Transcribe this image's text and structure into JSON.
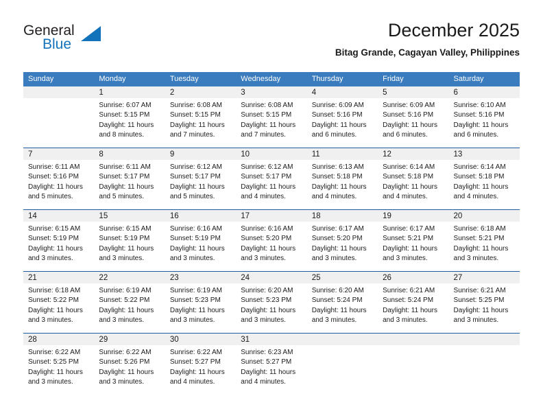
{
  "logo": {
    "word_one": "General",
    "word_two": "Blue",
    "accent_color": "#1272ba",
    "triangle_icon": "triangle-icon"
  },
  "header": {
    "title": "December 2025",
    "subtitle": "Bitag Grande, Cagayan Valley, Philippines"
  },
  "calendar": {
    "header_bg": "#3a7cbe",
    "daynum_bg": "#f0f0f0",
    "divider_color": "#1c5c9e",
    "weekday_headers": [
      "Sunday",
      "Monday",
      "Tuesday",
      "Wednesday",
      "Thursday",
      "Friday",
      "Saturday"
    ],
    "weeks": [
      [
        {
          "day": "",
          "sunrise": "",
          "sunset": "",
          "daylight_1": "",
          "daylight_2": ""
        },
        {
          "day": "1",
          "sunrise": "Sunrise: 6:07 AM",
          "sunset": "Sunset: 5:15 PM",
          "daylight_1": "Daylight: 11 hours",
          "daylight_2": "and 8 minutes."
        },
        {
          "day": "2",
          "sunrise": "Sunrise: 6:08 AM",
          "sunset": "Sunset: 5:15 PM",
          "daylight_1": "Daylight: 11 hours",
          "daylight_2": "and 7 minutes."
        },
        {
          "day": "3",
          "sunrise": "Sunrise: 6:08 AM",
          "sunset": "Sunset: 5:15 PM",
          "daylight_1": "Daylight: 11 hours",
          "daylight_2": "and 7 minutes."
        },
        {
          "day": "4",
          "sunrise": "Sunrise: 6:09 AM",
          "sunset": "Sunset: 5:16 PM",
          "daylight_1": "Daylight: 11 hours",
          "daylight_2": "and 6 minutes."
        },
        {
          "day": "5",
          "sunrise": "Sunrise: 6:09 AM",
          "sunset": "Sunset: 5:16 PM",
          "daylight_1": "Daylight: 11 hours",
          "daylight_2": "and 6 minutes."
        },
        {
          "day": "6",
          "sunrise": "Sunrise: 6:10 AM",
          "sunset": "Sunset: 5:16 PM",
          "daylight_1": "Daylight: 11 hours",
          "daylight_2": "and 6 minutes."
        }
      ],
      [
        {
          "day": "7",
          "sunrise": "Sunrise: 6:11 AM",
          "sunset": "Sunset: 5:16 PM",
          "daylight_1": "Daylight: 11 hours",
          "daylight_2": "and 5 minutes."
        },
        {
          "day": "8",
          "sunrise": "Sunrise: 6:11 AM",
          "sunset": "Sunset: 5:17 PM",
          "daylight_1": "Daylight: 11 hours",
          "daylight_2": "and 5 minutes."
        },
        {
          "day": "9",
          "sunrise": "Sunrise: 6:12 AM",
          "sunset": "Sunset: 5:17 PM",
          "daylight_1": "Daylight: 11 hours",
          "daylight_2": "and 5 minutes."
        },
        {
          "day": "10",
          "sunrise": "Sunrise: 6:12 AM",
          "sunset": "Sunset: 5:17 PM",
          "daylight_1": "Daylight: 11 hours",
          "daylight_2": "and 4 minutes."
        },
        {
          "day": "11",
          "sunrise": "Sunrise: 6:13 AM",
          "sunset": "Sunset: 5:18 PM",
          "daylight_1": "Daylight: 11 hours",
          "daylight_2": "and 4 minutes."
        },
        {
          "day": "12",
          "sunrise": "Sunrise: 6:14 AM",
          "sunset": "Sunset: 5:18 PM",
          "daylight_1": "Daylight: 11 hours",
          "daylight_2": "and 4 minutes."
        },
        {
          "day": "13",
          "sunrise": "Sunrise: 6:14 AM",
          "sunset": "Sunset: 5:18 PM",
          "daylight_1": "Daylight: 11 hours",
          "daylight_2": "and 4 minutes."
        }
      ],
      [
        {
          "day": "14",
          "sunrise": "Sunrise: 6:15 AM",
          "sunset": "Sunset: 5:19 PM",
          "daylight_1": "Daylight: 11 hours",
          "daylight_2": "and 3 minutes."
        },
        {
          "day": "15",
          "sunrise": "Sunrise: 6:15 AM",
          "sunset": "Sunset: 5:19 PM",
          "daylight_1": "Daylight: 11 hours",
          "daylight_2": "and 3 minutes."
        },
        {
          "day": "16",
          "sunrise": "Sunrise: 6:16 AM",
          "sunset": "Sunset: 5:19 PM",
          "daylight_1": "Daylight: 11 hours",
          "daylight_2": "and 3 minutes."
        },
        {
          "day": "17",
          "sunrise": "Sunrise: 6:16 AM",
          "sunset": "Sunset: 5:20 PM",
          "daylight_1": "Daylight: 11 hours",
          "daylight_2": "and 3 minutes."
        },
        {
          "day": "18",
          "sunrise": "Sunrise: 6:17 AM",
          "sunset": "Sunset: 5:20 PM",
          "daylight_1": "Daylight: 11 hours",
          "daylight_2": "and 3 minutes."
        },
        {
          "day": "19",
          "sunrise": "Sunrise: 6:17 AM",
          "sunset": "Sunset: 5:21 PM",
          "daylight_1": "Daylight: 11 hours",
          "daylight_2": "and 3 minutes."
        },
        {
          "day": "20",
          "sunrise": "Sunrise: 6:18 AM",
          "sunset": "Sunset: 5:21 PM",
          "daylight_1": "Daylight: 11 hours",
          "daylight_2": "and 3 minutes."
        }
      ],
      [
        {
          "day": "21",
          "sunrise": "Sunrise: 6:18 AM",
          "sunset": "Sunset: 5:22 PM",
          "daylight_1": "Daylight: 11 hours",
          "daylight_2": "and 3 minutes."
        },
        {
          "day": "22",
          "sunrise": "Sunrise: 6:19 AM",
          "sunset": "Sunset: 5:22 PM",
          "daylight_1": "Daylight: 11 hours",
          "daylight_2": "and 3 minutes."
        },
        {
          "day": "23",
          "sunrise": "Sunrise: 6:19 AM",
          "sunset": "Sunset: 5:23 PM",
          "daylight_1": "Daylight: 11 hours",
          "daylight_2": "and 3 minutes."
        },
        {
          "day": "24",
          "sunrise": "Sunrise: 6:20 AM",
          "sunset": "Sunset: 5:23 PM",
          "daylight_1": "Daylight: 11 hours",
          "daylight_2": "and 3 minutes."
        },
        {
          "day": "25",
          "sunrise": "Sunrise: 6:20 AM",
          "sunset": "Sunset: 5:24 PM",
          "daylight_1": "Daylight: 11 hours",
          "daylight_2": "and 3 minutes."
        },
        {
          "day": "26",
          "sunrise": "Sunrise: 6:21 AM",
          "sunset": "Sunset: 5:24 PM",
          "daylight_1": "Daylight: 11 hours",
          "daylight_2": "and 3 minutes."
        },
        {
          "day": "27",
          "sunrise": "Sunrise: 6:21 AM",
          "sunset": "Sunset: 5:25 PM",
          "daylight_1": "Daylight: 11 hours",
          "daylight_2": "and 3 minutes."
        }
      ],
      [
        {
          "day": "28",
          "sunrise": "Sunrise: 6:22 AM",
          "sunset": "Sunset: 5:25 PM",
          "daylight_1": "Daylight: 11 hours",
          "daylight_2": "and 3 minutes."
        },
        {
          "day": "29",
          "sunrise": "Sunrise: 6:22 AM",
          "sunset": "Sunset: 5:26 PM",
          "daylight_1": "Daylight: 11 hours",
          "daylight_2": "and 3 minutes."
        },
        {
          "day": "30",
          "sunrise": "Sunrise: 6:22 AM",
          "sunset": "Sunset: 5:27 PM",
          "daylight_1": "Daylight: 11 hours",
          "daylight_2": "and 4 minutes."
        },
        {
          "day": "31",
          "sunrise": "Sunrise: 6:23 AM",
          "sunset": "Sunset: 5:27 PM",
          "daylight_1": "Daylight: 11 hours",
          "daylight_2": "and 4 minutes."
        },
        {
          "day": "",
          "sunrise": "",
          "sunset": "",
          "daylight_1": "",
          "daylight_2": ""
        },
        {
          "day": "",
          "sunrise": "",
          "sunset": "",
          "daylight_1": "",
          "daylight_2": ""
        },
        {
          "day": "",
          "sunrise": "",
          "sunset": "",
          "daylight_1": "",
          "daylight_2": ""
        }
      ]
    ]
  }
}
